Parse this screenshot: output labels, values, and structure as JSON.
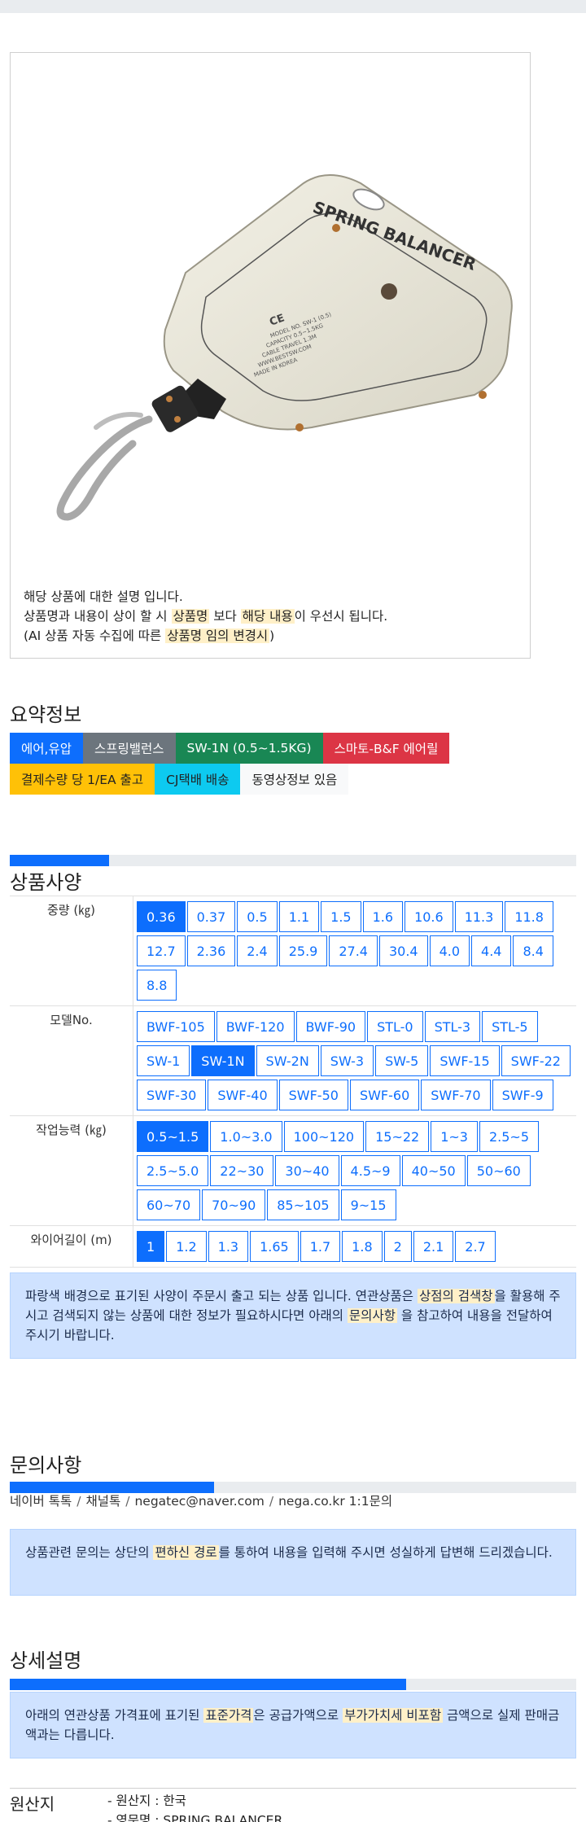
{
  "product": {
    "desc_line1": "해당 상품에 대한 설명 입니다.",
    "desc_line2_a": "상품명과 내용이 상이 할 시 ",
    "desc_line2_hl1": "상품명",
    "desc_line2_b": " 보다 ",
    "desc_line2_hl2": "해당 내용",
    "desc_line2_c": "이 우선시 됩니다.",
    "desc_line3_a": "(AI 상품 자동 수집에 따른 ",
    "desc_line3_hl": "상품명 임의 변경시",
    "desc_line3_b": ")",
    "image_text_top": "SPRING BALANCER",
    "image_text_logo": "BEST"
  },
  "summary": {
    "title": "요약정보",
    "row1": [
      {
        "label": "에어,유압",
        "bg": "#0d6efd",
        "fg": "#ffffff"
      },
      {
        "label": "스프링밸런스",
        "bg": "#6c757d",
        "fg": "#ffffff"
      },
      {
        "label": "SW-1N (0.5~1.5KG)",
        "bg": "#198754",
        "fg": "#ffffff"
      },
      {
        "label": "스마토-B&F 에어릴",
        "bg": "#dc3545",
        "fg": "#ffffff"
      }
    ],
    "row2": [
      {
        "label": "결제수량 당 1/EA 출고",
        "bg": "#ffc107",
        "fg": "#222222"
      },
      {
        "label": "CJ택배 배송",
        "bg": "#0dcaf0",
        "fg": "#222222"
      },
      {
        "label": "동영상정보 있음",
        "bg": "#f8f9fa",
        "fg": "#222222"
      }
    ]
  },
  "specs": {
    "title": "상품사양",
    "rows": [
      {
        "label": "중량 (㎏)",
        "options": [
          "0.36",
          "0.37",
          "0.5",
          "1.1",
          "1.5",
          "1.6",
          "10.6",
          "11.3",
          "11.8",
          "12.7",
          "2.36",
          "2.4",
          "25.9",
          "27.4",
          "30.4",
          "4.0",
          "4.4",
          "8.4",
          "8.8"
        ],
        "selected": "0.36"
      },
      {
        "label": "모델No.",
        "options": [
          "BWF-105",
          "BWF-120",
          "BWF-90",
          "STL-0",
          "STL-3",
          "STL-5",
          "SW-1",
          "SW-1N",
          "SW-2N",
          "SW-3",
          "SW-5",
          "SWF-15",
          "SWF-22",
          "SWF-30",
          "SWF-40",
          "SWF-50",
          "SWF-60",
          "SWF-70",
          "SWF-9"
        ],
        "selected": "SW-1N"
      },
      {
        "label": "작업능력 (㎏)",
        "options": [
          "0.5~1.5",
          "1.0~3.0",
          "100~120",
          "15~22",
          "1~3",
          "2.5~5",
          "2.5~5.0",
          "22~30",
          "30~40",
          "4.5~9",
          "40~50",
          "50~60",
          "60~70",
          "70~90",
          "85~105",
          "9~15"
        ],
        "selected": "0.5~1.5"
      },
      {
        "label": "와이어길이 (m)",
        "options": [
          "1",
          "1.2",
          "1.3",
          "1.65",
          "1.7",
          "1.8",
          "2",
          "2.1",
          "2.7"
        ],
        "selected": "1"
      }
    ],
    "notice_a": "파랑색 배경으로 표기된 사양이 주문시 출고 되는 상품 입니다. 연관상품은 ",
    "notice_hl1": "상점의 검색창",
    "notice_b": "을 활용해 주시고 검색되지 않는 상품에 대한 정보가 필요하시다면 아래의 ",
    "notice_hl2": "문의사항",
    "notice_c": " 을 참고하여 내용을 전달하여 주시기 바랍니다."
  },
  "inquiry": {
    "title": "문의사항",
    "progress": 0.36,
    "contacts": [
      "네이버 톡톡",
      "채널톡",
      "negatec@naver.com",
      "nega.co.kr 1:1문의"
    ],
    "notice_a": "상품관련 문의는 상단의 ",
    "notice_hl": "편하신 경로",
    "notice_b": "를 통하여 내용을 입력해 주시면 성실하게 답변해 드리겠습니다."
  },
  "detail": {
    "title": "상세설명",
    "progress": 0.7,
    "notice_a": "아래의 연관상품 가격표에 표기된 ",
    "notice_hl1": "표준가격",
    "notice_b": "은 공급가액으로 ",
    "notice_hl2": "부가가치세 비포함",
    "notice_c": " 금액으로 실제 판매금액과는 다릅니다."
  },
  "specs_progress": 0.175,
  "origin": {
    "label": "원산지",
    "items": [
      "- 원산지 : 한국",
      "- 영문명 : SPRING BALANCER"
    ]
  }
}
